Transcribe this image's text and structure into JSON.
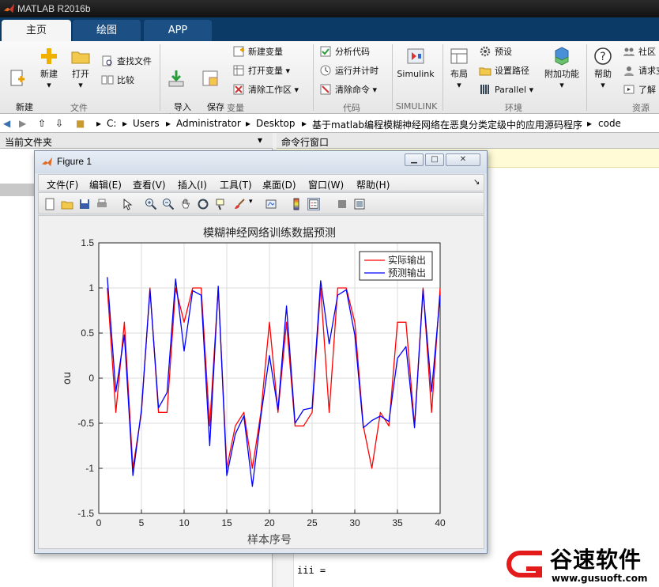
{
  "app": {
    "title": "MATLAB R2016b"
  },
  "tabs": [
    {
      "label": "主页"
    },
    {
      "label": "绘图"
    },
    {
      "label": "APP"
    }
  ],
  "ribbon": {
    "file": {
      "new_script": "新建\n脚本",
      "new": "新建",
      "open": "打开",
      "find_files": "查找文件",
      "compare": "比较",
      "group": "文件"
    },
    "variable": {
      "import": "导入\n数据",
      "save_ws": "保存\n工作区",
      "new_var": "新建变量",
      "open_var": "打开变量",
      "clear_ws": "清除工作区",
      "group": "变量"
    },
    "code": {
      "analyze": "分析代码",
      "run_time": "运行并计时",
      "clear_cmd": "清除命令",
      "group": "代码"
    },
    "simulink": {
      "label": "Simulink",
      "group": "SIMULINK"
    },
    "env": {
      "layout": "布局",
      "prefs": "预设",
      "set_path": "设置路径",
      "parallel": "Parallel",
      "addons": "附加功能",
      "group": "环境"
    },
    "resources": {
      "help": "帮助",
      "community": "社区",
      "request": "请求支",
      "learn": "了解",
      "group": "资源"
    }
  },
  "address": {
    "segments": [
      "C:",
      "Users",
      "Administrator",
      "Desktop",
      "基于matlab编程模糊神经网络在恶臭分类定级中的应用源码程序",
      "code"
    ]
  },
  "panels": {
    "current_folder": "当前文件夹",
    "command_window": "命令行窗口",
    "cmd_line": "iii ="
  },
  "figure": {
    "title": "Figure 1",
    "menu": [
      "文件(F)",
      "编辑(E)",
      "查看(V)",
      "插入(I)",
      "工具(T)",
      "桌面(D)",
      "窗口(W)",
      "帮助(H)"
    ]
  },
  "chart_data": {
    "type": "line",
    "title": "模糊神经网络训练数据预测",
    "xlabel": "样本序号",
    "ylabel": "ou",
    "xlim": [
      0,
      40
    ],
    "ylim": [
      -1.5,
      1.5
    ],
    "xticks": [
      0,
      5,
      10,
      15,
      20,
      25,
      30,
      35,
      40
    ],
    "yticks": [
      -1.5,
      -1,
      -0.5,
      0,
      0.5,
      1,
      1.5
    ],
    "grid": true,
    "legend_position": "top-right",
    "x": [
      1,
      2,
      3,
      4,
      5,
      6,
      7,
      8,
      9,
      10,
      11,
      12,
      13,
      14,
      15,
      16,
      17,
      18,
      19,
      20,
      21,
      22,
      23,
      24,
      25,
      26,
      27,
      28,
      29,
      30,
      31,
      32,
      33,
      34,
      35,
      36,
      37,
      38,
      39,
      40
    ],
    "series": [
      {
        "name": "实际输出",
        "color": "#ff0000",
        "values": [
          1,
          -0.38,
          0.62,
          -1,
          -0.38,
          1,
          -0.38,
          -0.38,
          1,
          0.62,
          1,
          1,
          -0.53,
          1,
          -1,
          -0.53,
          -0.38,
          -1,
          -0.38,
          0.62,
          -0.38,
          0.62,
          -0.53,
          -0.53,
          -0.38,
          1,
          -0.38,
          1,
          1,
          0.62,
          -0.53,
          -1,
          -0.38,
          -0.53,
          0.62,
          0.62,
          -0.53,
          1,
          -0.38,
          1
        ]
      },
      {
        "name": "预测输出",
        "color": "#0000ff",
        "values": [
          1.12,
          -0.15,
          0.48,
          -1.08,
          -0.35,
          0.98,
          -0.33,
          -0.16,
          1.1,
          0.3,
          0.97,
          0.92,
          -0.75,
          1.02,
          -1.08,
          -0.62,
          -0.42,
          -1.2,
          -0.42,
          0.25,
          -0.35,
          0.8,
          -0.5,
          -0.35,
          -0.33,
          1.08,
          0.38,
          0.92,
          0.98,
          0.48,
          -0.55,
          -0.47,
          -0.42,
          -0.48,
          0.22,
          0.35,
          -0.55,
          0.98,
          -0.15,
          0.92
        ]
      }
    ]
  },
  "watermark": {
    "brand": "谷速软件",
    "url": "www.gusuoft.com"
  }
}
